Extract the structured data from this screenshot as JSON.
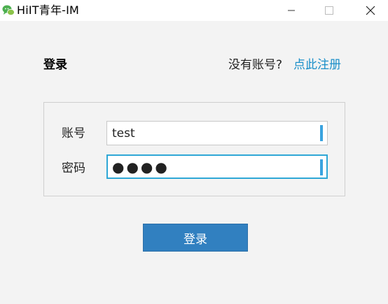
{
  "window": {
    "title": "HiIT青年-IM",
    "icon": "chat-bubbles-icon",
    "controls": {
      "minimize": "minimize-icon",
      "maximize": "maximize-icon",
      "close": "close-icon"
    }
  },
  "login": {
    "heading": "登录",
    "no_account_text": "没有账号?",
    "register_link": "点此注册",
    "account_label": "账号",
    "account_value": "test",
    "password_label": "密码",
    "password_value": "●●●●",
    "submit_label": "登录"
  },
  "colors": {
    "background": "#f3f3f3",
    "accent_link": "#1a8fc9",
    "focus_border": "#2ea7d6",
    "button": "#3180c0"
  }
}
